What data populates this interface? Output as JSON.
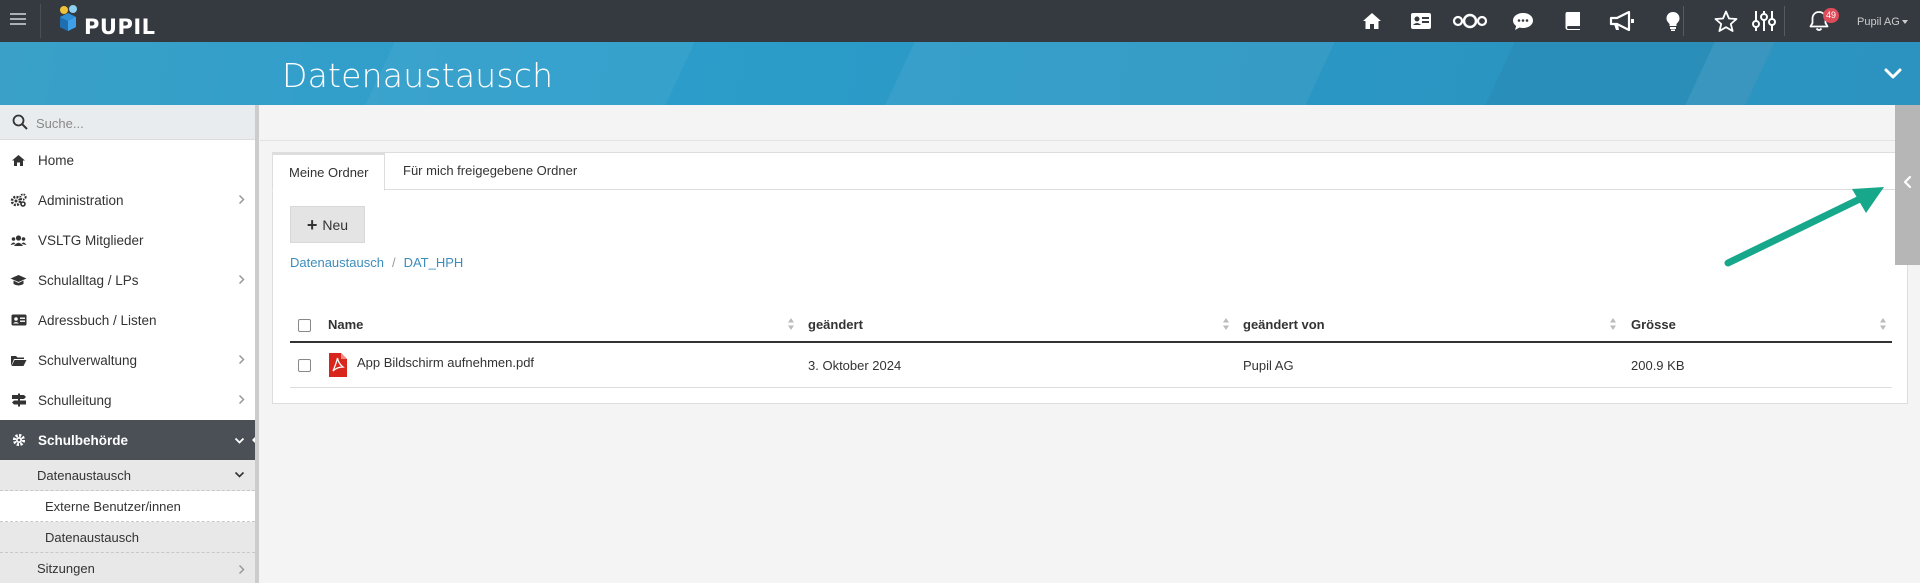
{
  "topbar": {
    "logo_text": "PUPIL",
    "notification_count": "49",
    "user_label": "Pupil AG",
    "icons": [
      "home-icon",
      "address-card-icon",
      "nextcloud-icon",
      "chat-icon",
      "book-icon",
      "megaphone-icon",
      "lightbulb-icon",
      "star-icon",
      "sliders-icon",
      "bell-icon"
    ]
  },
  "header": {
    "title": "Datenaustausch"
  },
  "sidebar": {
    "search_placeholder": "Suche...",
    "items": [
      {
        "label": "Home",
        "icon": "home-icon",
        "has_chevron": false
      },
      {
        "label": "Administration",
        "icon": "cogs-icon",
        "has_chevron": true
      },
      {
        "label": "VSLTG Mitglieder",
        "icon": "users-icon",
        "has_chevron": false
      },
      {
        "label": "Schulalltag / LPs",
        "icon": "graduation-cap-icon",
        "has_chevron": true
      },
      {
        "label": "Adressbuch / Listen",
        "icon": "address-card-icon",
        "has_chevron": false
      },
      {
        "label": "Schulverwaltung",
        "icon": "folder-open-icon",
        "has_chevron": true
      },
      {
        "label": "Schulleitung",
        "icon": "signpost-icon",
        "has_chevron": true
      },
      {
        "label": "Schulbehörde",
        "icon": "cog-icon",
        "has_chevron": true,
        "active": true
      }
    ],
    "sub": {
      "parent_label": "Datenaustausch",
      "children": [
        "Externe Benutzer/innen",
        "Datenaustausch"
      ]
    },
    "after_sub": {
      "label": "Sitzungen"
    }
  },
  "main": {
    "tabs": [
      {
        "label": "Meine Ordner",
        "active": true
      },
      {
        "label": "Für mich freigegebene Ordner",
        "active": false
      }
    ],
    "new_button": "Neu",
    "breadcrumb": [
      "Datenaustausch",
      "DAT_HPH"
    ],
    "table": {
      "headers": [
        "Name",
        "geändert",
        "geändert von",
        "Grösse"
      ],
      "rows": [
        {
          "name": "App Bildschirm aufnehmen.pdf",
          "changed": "3. Oktober 2024",
          "changed_by": "Pupil AG",
          "size": "200.9 KB"
        }
      ]
    }
  },
  "colors": {
    "topbar": "#343a40",
    "header": "#2c9ecb",
    "active_menu": "#4a5056",
    "link": "#3c8dbc",
    "arrow": "#17a78a",
    "pdf": "#d9261c"
  }
}
